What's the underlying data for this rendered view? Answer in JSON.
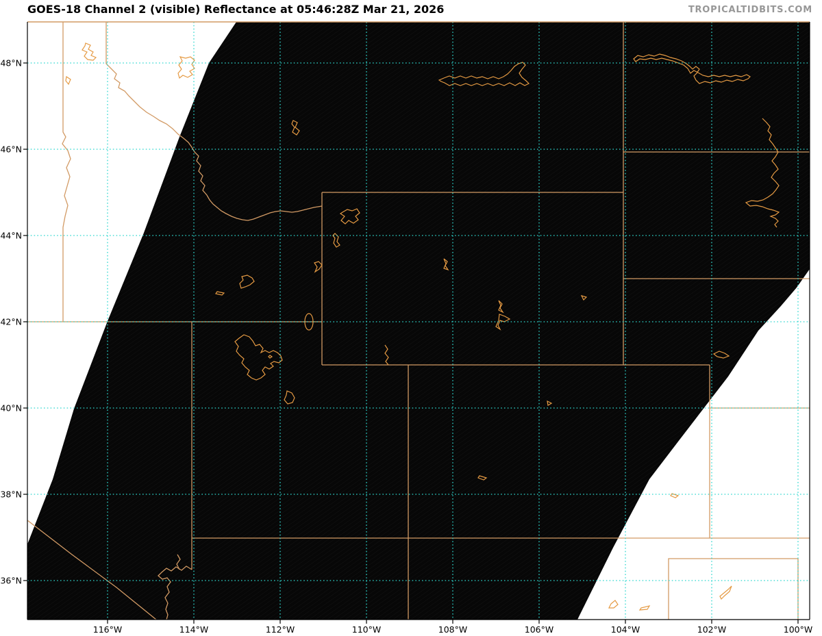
{
  "header": {
    "title": "GOES-18 Channel 2 (visible) Reflectance at 05:46:28Z Mar 21, 2026",
    "watermark": "TROPICALTIDBITS.COM"
  },
  "map": {
    "satellite": "GOES-18",
    "channel": "Channel 2 (visible) Reflectance",
    "valid_time": "05:46:28Z Mar 21, 2026"
  },
  "axes": {
    "lat": [
      {
        "label": "48°N"
      },
      {
        "label": "46°N"
      },
      {
        "label": "44°N"
      },
      {
        "label": "42°N"
      },
      {
        "label": "40°N"
      },
      {
        "label": "38°N"
      },
      {
        "label": "36°N"
      }
    ],
    "lon": [
      {
        "label": "116°W"
      },
      {
        "label": "114°W"
      },
      {
        "label": "112°W"
      },
      {
        "label": "110°W"
      },
      {
        "label": "108°W"
      },
      {
        "label": "106°W"
      },
      {
        "label": "104°W"
      },
      {
        "label": "102°W"
      },
      {
        "label": "100°W"
      }
    ]
  },
  "colors": {
    "border_tan": "#d29a64",
    "water_orange": "#e59a43",
    "grid_cyan": "#2ed8cf",
    "night_black": "#070707",
    "watermark_gray": "#979797"
  }
}
